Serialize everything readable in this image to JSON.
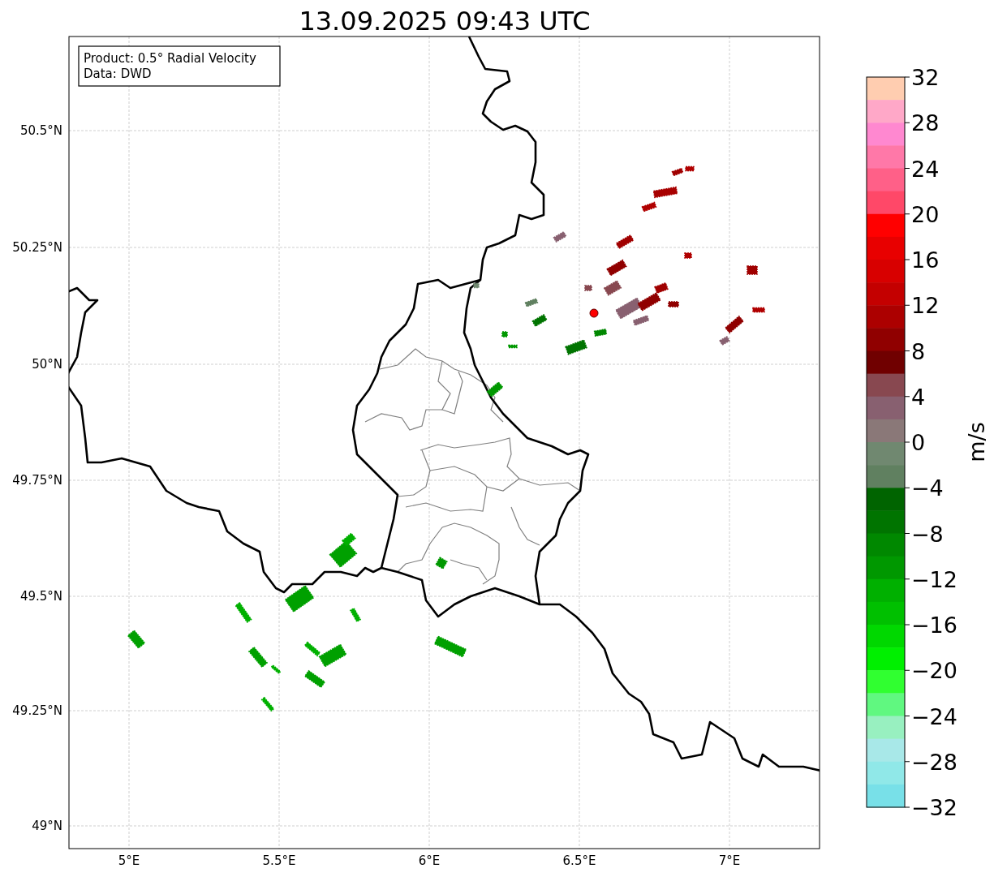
{
  "title": "13.09.2025 09:43 UTC",
  "info_box": {
    "lines": [
      "Product: 0.5° Radial Velocity",
      "Data: DWD"
    ]
  },
  "y_ticks": [
    "50.5°N",
    "50.25°N",
    "50°N",
    "49.75°N",
    "49.5°N",
    "49.25°N",
    "49°N"
  ],
  "x_ticks": [
    "5°E",
    "5.5°E",
    "6°E",
    "6.5°E",
    "7°E"
  ],
  "colorbar": {
    "label": "m/s",
    "ticks": [
      "32",
      "28",
      "24",
      "20",
      "16",
      "12",
      "8",
      "4",
      "0",
      "−4",
      "−8",
      "−12",
      "−16",
      "−20",
      "−24",
      "−28",
      "−32"
    ],
    "bands": [
      {
        "color": "#ffcdb0"
      },
      {
        "color": "#ffa8c8"
      },
      {
        "color": "#ff88d0"
      },
      {
        "color": "#ff78a8"
      },
      {
        "color": "#ff6088"
      },
      {
        "color": "#ff4868"
      },
      {
        "color": "#ff0000"
      },
      {
        "color": "#e80000"
      },
      {
        "color": "#d80000"
      },
      {
        "color": "#c40000"
      },
      {
        "color": "#ac0000"
      },
      {
        "color": "#900000"
      },
      {
        "color": "#700000"
      },
      {
        "color": "#884850"
      },
      {
        "color": "#886070"
      },
      {
        "color": "#8a7878"
      },
      {
        "color": "#708870"
      },
      {
        "color": "#608060"
      },
      {
        "color": "#006400"
      },
      {
        "color": "#007400"
      },
      {
        "color": "#008800"
      },
      {
        "color": "#009800"
      },
      {
        "color": "#00b000"
      },
      {
        "color": "#00c000"
      },
      {
        "color": "#00d800"
      },
      {
        "color": "#00f000"
      },
      {
        "color": "#30ff30"
      },
      {
        "color": "#60f880"
      },
      {
        "color": "#98f0c0"
      },
      {
        "color": "#a8e8e8"
      },
      {
        "color": "#90e8e8"
      },
      {
        "color": "#78e0e8"
      }
    ]
  }
}
